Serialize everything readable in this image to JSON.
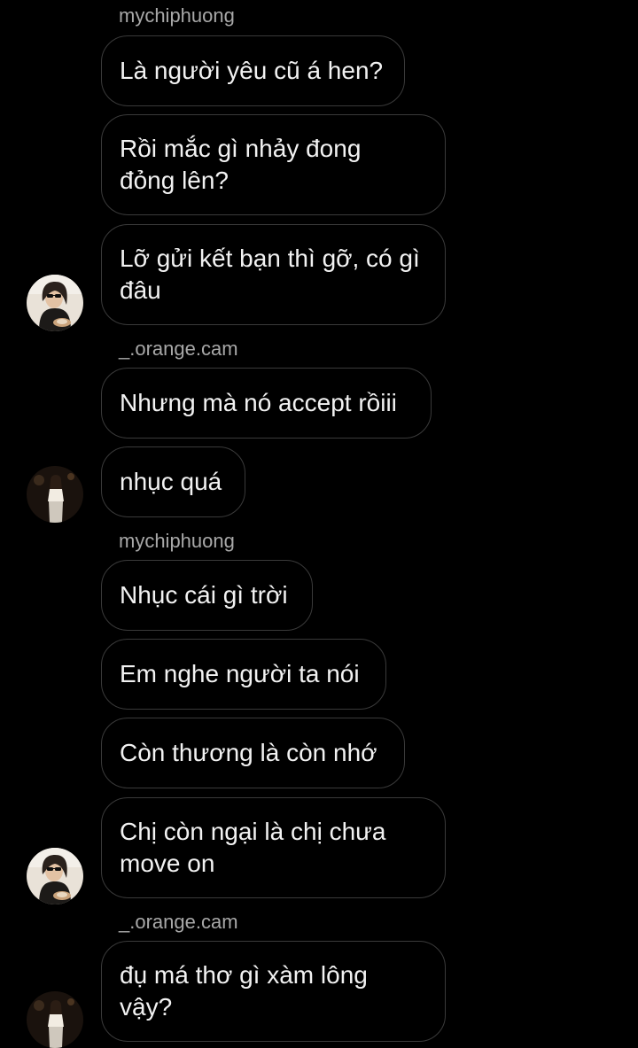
{
  "messages": [
    {
      "sender": "mychiphuong",
      "text": "Là người yêu cũ á hen?"
    },
    {
      "sender": "mychiphuong",
      "text": "Rồi mắc gì nhảy đong đỏng lên?"
    },
    {
      "sender": "mychiphuong",
      "text": "Lỡ gửi kết bạn thì gỡ, có gì đâu"
    },
    {
      "sender": "_.orange.cam",
      "text": "Nhưng mà nó accept rồiii"
    },
    {
      "sender": "_.orange.cam",
      "text": "nhục quá"
    },
    {
      "sender": "mychiphuong",
      "text": "Nhục cái gì trời"
    },
    {
      "sender": "mychiphuong",
      "text": "Em nghe người ta nói"
    },
    {
      "sender": "mychiphuong",
      "text": "Còn thương là còn nhớ"
    },
    {
      "sender": "mychiphuong",
      "text": "Chị còn ngại là chị chưa move on"
    },
    {
      "sender": "_.orange.cam",
      "text": "đụ má thơ gì xàm lông vậy?"
    }
  ],
  "senders": {
    "top": "mychiphuong",
    "orange_1": "_.orange.cam",
    "mychi_2": "mychiphuong",
    "orange_2": "_.orange.cam"
  },
  "avatars": {
    "mychiphuong": "avatar-woman-sunglasses",
    "orange_cam": "avatar-woman-standing"
  },
  "colors": {
    "background": "#000000",
    "bubble_border": "#3a3a3a",
    "username": "#a8a8a8",
    "text": "#ffffff"
  }
}
